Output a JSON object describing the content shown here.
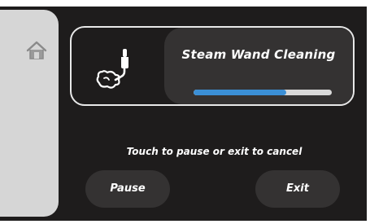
{
  "sidebar": {
    "home_icon": "home-icon"
  },
  "status_card": {
    "icon": "steam-wand-icon",
    "title": "Steam Wand Cleaning",
    "progress_fraction": 0.67
  },
  "hint_text": "Touch to pause or exit to cancel",
  "buttons": {
    "pause_label": "Pause",
    "exit_label": "Exit"
  },
  "colors": {
    "background": "#1e1c1c",
    "panel": "#343232",
    "sidebar": "#d6d6d6",
    "progress_fill": "#3b8fd6",
    "progress_track": "#d9d9d9",
    "text": "#ffffff"
  }
}
